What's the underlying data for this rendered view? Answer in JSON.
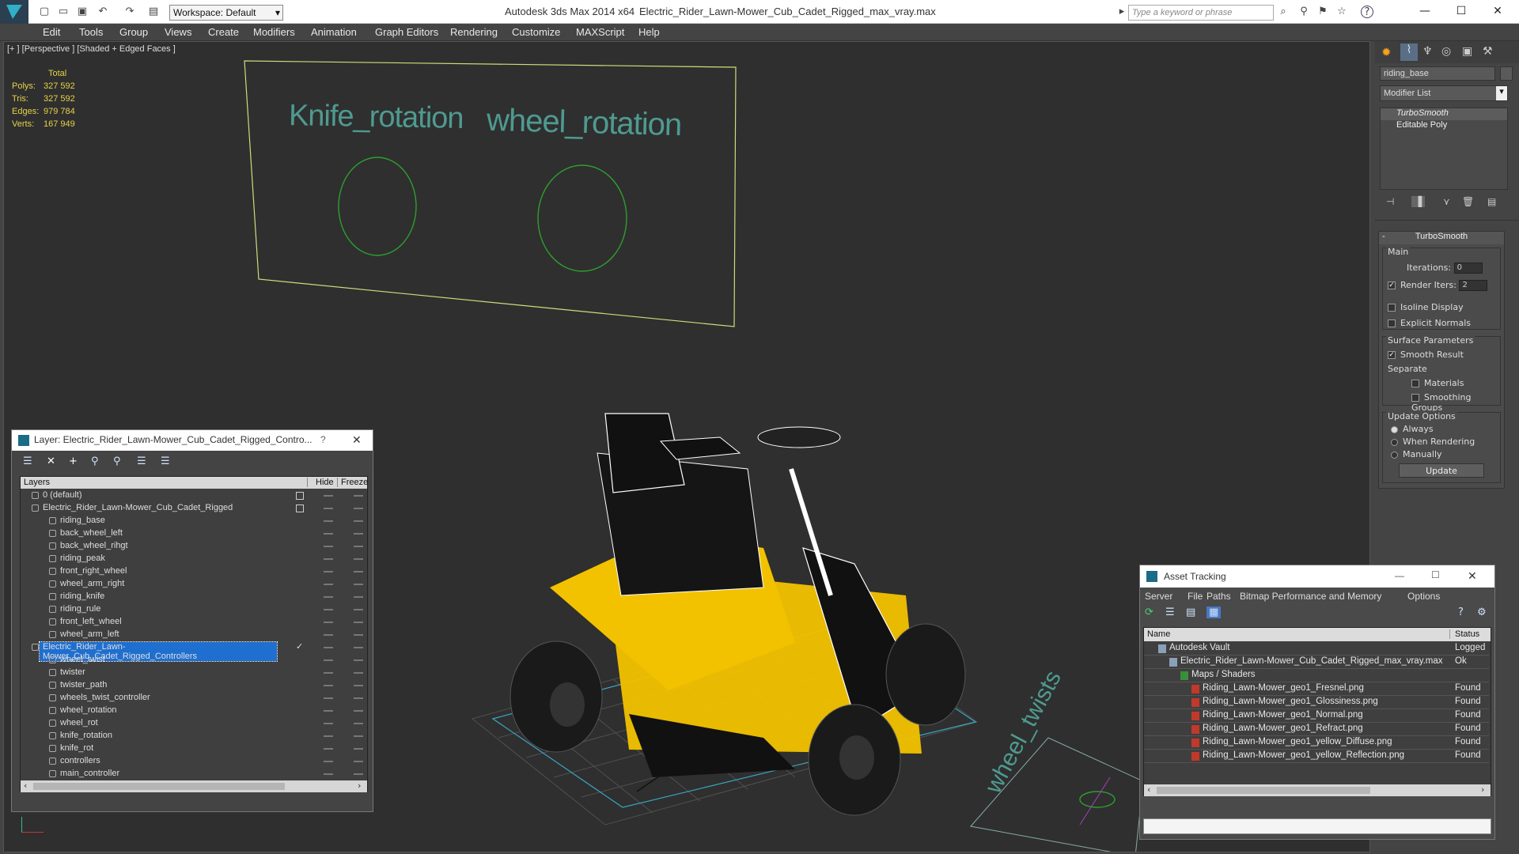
{
  "titlebar": {
    "app_title": "Autodesk 3ds Max  2014 x64",
    "file_title": "Electric_Rider_Lawn-Mower_Cub_Cadet_Rigged_max_vray.max",
    "workspace": "Workspace: Default",
    "search_placeholder": "Type a keyword or phrase"
  },
  "menu": [
    "Edit",
    "Tools",
    "Group",
    "Views",
    "Create",
    "Modifiers",
    "Animation",
    "Graph Editors",
    "Rendering",
    "Customize",
    "MAXScript",
    "Help"
  ],
  "viewport": {
    "label": "[+ ] [Perspective ] [Shaded + Edged Faces ]",
    "stats": {
      "header": "Total",
      "rows": [
        {
          "label": "Polys:",
          "value": "327 592"
        },
        {
          "label": "Tris:",
          "value": "327 592"
        },
        {
          "label": "Edges:",
          "value": "979 784"
        },
        {
          "label": "Verts:",
          "value": "167 949"
        }
      ]
    },
    "controller_text_1": "Knife_rotation",
    "controller_text_2": "wheel_rotation",
    "controller_text_3": "wheel_twists"
  },
  "command_panel": {
    "object_name": "riding_base",
    "modifier_list": "Modifier List",
    "stack": [
      "TurboSmooth",
      "Editable Poly"
    ],
    "rollout_title": "TurboSmooth",
    "main_label": "Main",
    "iterations_label": "Iterations:",
    "iterations_value": "0",
    "render_iters_label": "Render Iters:",
    "render_iters_value": "2",
    "isoline": "Isoline Display",
    "explicit_normals": "Explicit Normals",
    "surface_params": "Surface Parameters",
    "smooth_result": "Smooth Result",
    "separate": "Separate",
    "materials": "Materials",
    "smoothing_groups": "Smoothing Groups",
    "update_options": "Update Options",
    "always": "Always",
    "when_rendering": "When Rendering",
    "manually": "Manually",
    "update_button": "Update"
  },
  "layer_window": {
    "title": "Layer: Electric_Rider_Lawn-Mower_Cub_Cadet_Rigged_Contro...",
    "col_layers": "Layers",
    "col_hide": "Hide",
    "col_freeze": "Freeze",
    "rows": [
      {
        "name": "0 (default)",
        "level": 0,
        "type": "layer"
      },
      {
        "name": "Electric_Rider_Lawn-Mower_Cub_Cadet_Rigged",
        "level": 0,
        "type": "layer"
      },
      {
        "name": "riding_base",
        "level": 1,
        "type": "obj"
      },
      {
        "name": "back_wheel_left",
        "level": 1,
        "type": "obj"
      },
      {
        "name": "back_wheel_rihgt",
        "level": 1,
        "type": "obj"
      },
      {
        "name": "riding_peak",
        "level": 1,
        "type": "obj"
      },
      {
        "name": "front_right_wheel",
        "level": 1,
        "type": "obj"
      },
      {
        "name": "wheel_arm_right",
        "level": 1,
        "type": "obj"
      },
      {
        "name": "riding_knife",
        "level": 1,
        "type": "obj"
      },
      {
        "name": "riding_rule",
        "level": 1,
        "type": "obj"
      },
      {
        "name": "front_left_wheel",
        "level": 1,
        "type": "obj"
      },
      {
        "name": "wheel_arm_left",
        "level": 1,
        "type": "obj"
      },
      {
        "name": "Electric_Rider_Lawn-Mower_Cub_Cadet_Rigged_Controllers",
        "level": 0,
        "type": "layer",
        "selected": true
      },
      {
        "name": "wheel_twist",
        "level": 1,
        "type": "obj"
      },
      {
        "name": "twister",
        "level": 1,
        "type": "obj"
      },
      {
        "name": "twister_path",
        "level": 1,
        "type": "obj"
      },
      {
        "name": "wheels_twist_controller",
        "level": 1,
        "type": "obj"
      },
      {
        "name": "wheel_rotation",
        "level": 1,
        "type": "obj"
      },
      {
        "name": "wheel_rot",
        "level": 1,
        "type": "obj"
      },
      {
        "name": "knife_rotation",
        "level": 1,
        "type": "obj"
      },
      {
        "name": "knife_rot",
        "level": 1,
        "type": "obj"
      },
      {
        "name": "controllers",
        "level": 1,
        "type": "obj"
      },
      {
        "name": "main_controller",
        "level": 1,
        "type": "obj"
      }
    ]
  },
  "asset_window": {
    "title": "Asset Tracking",
    "menu": [
      "Server",
      "File",
      "Paths",
      "Bitmap Performance and Memory",
      "Options"
    ],
    "col_name": "Name",
    "col_status": "Status",
    "rows": [
      {
        "name": "Autodesk Vault",
        "status": "Logged",
        "level": 0
      },
      {
        "name": "Electric_Rider_Lawn-Mower_Cub_Cadet_Rigged_max_vray.max",
        "status": "Ok",
        "level": 1
      },
      {
        "name": "Maps / Shaders",
        "status": "",
        "level": 2
      },
      {
        "name": "Riding_Lawn-Mower_geo1_Fresnel.png",
        "status": "Found",
        "level": 3
      },
      {
        "name": "Riding_Lawn-Mower_geo1_Glossiness.png",
        "status": "Found",
        "level": 3
      },
      {
        "name": "Riding_Lawn-Mower_geo1_Normal.png",
        "status": "Found",
        "level": 3
      },
      {
        "name": "Riding_Lawn-Mower_geo1_Refract.png",
        "status": "Found",
        "level": 3
      },
      {
        "name": "Riding_Lawn-Mower_geo1_yellow_Diffuse.png",
        "status": "Found",
        "level": 3
      },
      {
        "name": "Riding_Lawn-Mower_geo1_yellow_Reflection.png",
        "status": "Found",
        "level": 3
      }
    ]
  },
  "colors": {
    "accent_selection": "#1f6fd0",
    "stats_yellow": "#e6d247",
    "controller_green": "#3dbb3d",
    "mower_yellow": "#f2c200"
  }
}
